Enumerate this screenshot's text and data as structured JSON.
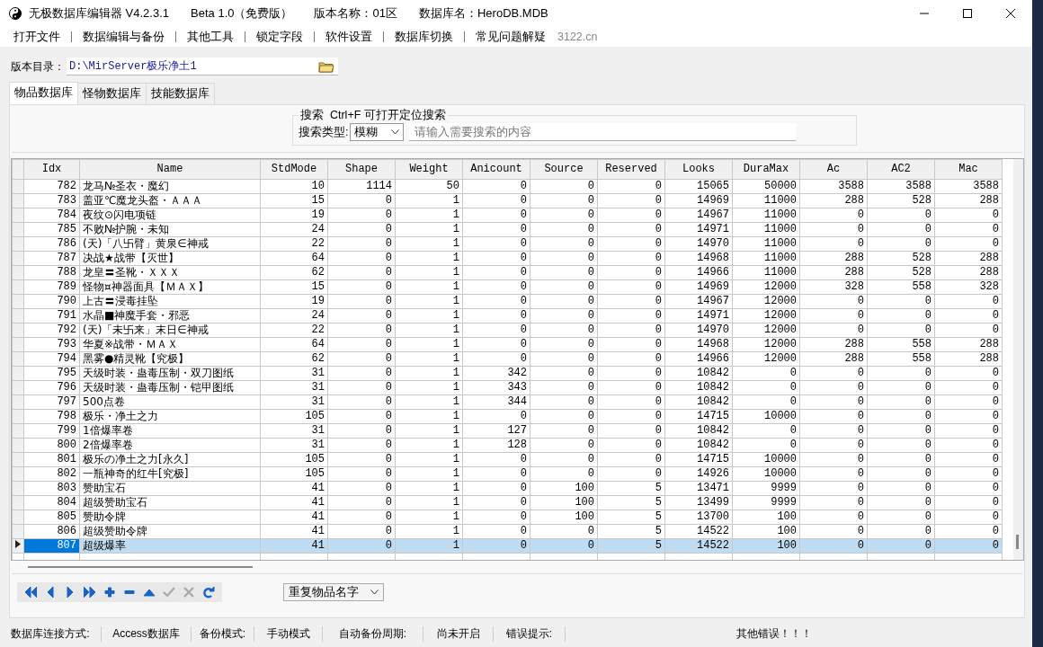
{
  "window": {
    "title_parts": [
      "无极数据库编辑器 V4.2.3.1",
      "Beta 1.0（免费版）",
      "版本名称：01区",
      "数据库名：HeroDB.MDB"
    ]
  },
  "menu": {
    "items": [
      "打开文件",
      "数据编辑与备份",
      "其他工具",
      "锁定字段",
      "软件设置",
      "数据库切换",
      "常见问题解疑"
    ],
    "site": "3122.cn"
  },
  "path": {
    "label": "版本目录：",
    "value": "D:\\MirServer极乐净土1"
  },
  "tabs": [
    {
      "label": "物品数据库",
      "selected": true
    },
    {
      "label": "怪物数据库",
      "selected": false
    },
    {
      "label": "技能数据库",
      "selected": false
    }
  ],
  "search": {
    "legend": "搜索  Ctrl+F 可打开定位搜索",
    "type_label": "搜索类型:",
    "type_value": "模糊",
    "placeholder": "请输入需要搜索的内容"
  },
  "table": {
    "columns": [
      "Idx",
      "Name",
      "StdMode",
      "Shape",
      "Weight",
      "Anicount",
      "Source",
      "Reserved",
      "Looks",
      "DuraMax",
      "Ac",
      "AC2",
      "Mac"
    ],
    "rows": [
      {
        "selected": false,
        "cells": [
          "782",
          "龙马№圣衣・魔幻",
          "10",
          "1114",
          "50",
          "0",
          "0",
          "0",
          "15065",
          "50000",
          "3588",
          "3588",
          "3588"
        ]
      },
      {
        "selected": false,
        "cells": [
          "783",
          "盖亚℃魔龙头盔・ＡＡＡ",
          "15",
          "0",
          "1",
          "0",
          "0",
          "0",
          "14969",
          "11000",
          "288",
          "528",
          "288"
        ]
      },
      {
        "selected": false,
        "cells": [
          "784",
          "夜纹⊙闪电项链",
          "19",
          "0",
          "1",
          "0",
          "0",
          "0",
          "14967",
          "11000",
          "0",
          "0",
          "0"
        ]
      },
      {
        "selected": false,
        "cells": [
          "785",
          "不败№护腕・未知",
          "24",
          "0",
          "1",
          "0",
          "0",
          "0",
          "14971",
          "11000",
          "0",
          "0",
          "0"
        ]
      },
      {
        "selected": false,
        "cells": [
          "786",
          "(天)「八卐臂」黄泉∈神戒",
          "22",
          "0",
          "1",
          "0",
          "0",
          "0",
          "14970",
          "11000",
          "0",
          "0",
          "0"
        ]
      },
      {
        "selected": false,
        "cells": [
          "787",
          "决战★战带【灭世】",
          "64",
          "0",
          "1",
          "0",
          "0",
          "0",
          "14968",
          "11000",
          "288",
          "528",
          "288"
        ]
      },
      {
        "selected": false,
        "cells": [
          "788",
          "龙皇〓圣靴・ＸＸＸ",
          "62",
          "0",
          "1",
          "0",
          "0",
          "0",
          "14966",
          "11000",
          "288",
          "528",
          "288"
        ]
      },
      {
        "selected": false,
        "cells": [
          "789",
          "怪物¤神器面具【ＭＡＸ】",
          "15",
          "0",
          "1",
          "0",
          "0",
          "0",
          "14969",
          "12000",
          "328",
          "558",
          "328"
        ]
      },
      {
        "selected": false,
        "cells": [
          "790",
          "上古〓浸毒挂坠",
          "19",
          "0",
          "1",
          "0",
          "0",
          "0",
          "14967",
          "12000",
          "0",
          "0",
          "0"
        ]
      },
      {
        "selected": false,
        "cells": [
          "791",
          "水晶■神魔手套・邪恶",
          "24",
          "0",
          "1",
          "0",
          "0",
          "0",
          "14971",
          "12000",
          "0",
          "0",
          "0"
        ]
      },
      {
        "selected": false,
        "cells": [
          "792",
          "(天)「未卐来」末日∈神戒",
          "22",
          "0",
          "1",
          "0",
          "0",
          "0",
          "14970",
          "12000",
          "0",
          "0",
          "0"
        ]
      },
      {
        "selected": false,
        "cells": [
          "793",
          "华夏※战带・ＭＡＸ",
          "64",
          "0",
          "1",
          "0",
          "0",
          "0",
          "14968",
          "12000",
          "288",
          "558",
          "288"
        ]
      },
      {
        "selected": false,
        "cells": [
          "794",
          "黑雾●精灵靴【究极】",
          "62",
          "0",
          "1",
          "0",
          "0",
          "0",
          "14966",
          "12000",
          "288",
          "558",
          "288"
        ]
      },
      {
        "selected": false,
        "cells": [
          "795",
          "天级时装・蛊毒压制・双刀图纸",
          "31",
          "0",
          "1",
          "342",
          "0",
          "0",
          "10842",
          "0",
          "0",
          "0",
          "0"
        ]
      },
      {
        "selected": false,
        "cells": [
          "796",
          "天级时装・蛊毒压制・铠甲图纸",
          "31",
          "0",
          "1",
          "343",
          "0",
          "0",
          "10842",
          "0",
          "0",
          "0",
          "0"
        ]
      },
      {
        "selected": false,
        "cells": [
          "797",
          "500点卷",
          "31",
          "0",
          "1",
          "344",
          "0",
          "0",
          "10842",
          "0",
          "0",
          "0",
          "0"
        ]
      },
      {
        "selected": false,
        "cells": [
          "798",
          "极乐・净土之力",
          "105",
          "0",
          "1",
          "0",
          "0",
          "0",
          "14715",
          "10000",
          "0",
          "0",
          "0"
        ]
      },
      {
        "selected": false,
        "cells": [
          "799",
          "1倍爆率卷",
          "31",
          "0",
          "1",
          "127",
          "0",
          "0",
          "10842",
          "0",
          "0",
          "0",
          "0"
        ]
      },
      {
        "selected": false,
        "cells": [
          "800",
          "2倍爆率卷",
          "31",
          "0",
          "1",
          "128",
          "0",
          "0",
          "10842",
          "0",
          "0",
          "0",
          "0"
        ]
      },
      {
        "selected": false,
        "cells": [
          "801",
          "极乐の净土之力[永久]",
          "105",
          "0",
          "1",
          "0",
          "0",
          "0",
          "14715",
          "10000",
          "0",
          "0",
          "0"
        ]
      },
      {
        "selected": false,
        "cells": [
          "802",
          "一瓶神奇的红牛[究极]",
          "105",
          "0",
          "1",
          "0",
          "0",
          "0",
          "14926",
          "10000",
          "0",
          "0",
          "0"
        ]
      },
      {
        "selected": false,
        "cells": [
          "803",
          "赞助宝石",
          "41",
          "0",
          "1",
          "0",
          "100",
          "5",
          "13471",
          "9999",
          "0",
          "0",
          "0"
        ]
      },
      {
        "selected": false,
        "cells": [
          "804",
          "超级赞助宝石",
          "41",
          "0",
          "1",
          "0",
          "100",
          "5",
          "13499",
          "9999",
          "0",
          "0",
          "0"
        ]
      },
      {
        "selected": false,
        "cells": [
          "805",
          "赞助令牌",
          "41",
          "0",
          "1",
          "0",
          "100",
          "5",
          "13700",
          "100",
          "0",
          "0",
          "0"
        ]
      },
      {
        "selected": false,
        "cells": [
          "806",
          "超级赞助令牌",
          "41",
          "0",
          "1",
          "0",
          "0",
          "5",
          "14522",
          "100",
          "0",
          "0",
          "0"
        ]
      },
      {
        "selected": true,
        "cells": [
          "807",
          "超级爆率",
          "41",
          "0",
          "1",
          "0",
          "0",
          "5",
          "14522",
          "100",
          "0",
          "0",
          "0"
        ]
      }
    ]
  },
  "navigator": {
    "buttons": [
      {
        "kind": "first",
        "disabled": false
      },
      {
        "kind": "prior",
        "disabled": false
      },
      {
        "kind": "next",
        "disabled": false
      },
      {
        "kind": "last",
        "disabled": false
      },
      {
        "kind": "insert",
        "disabled": false
      },
      {
        "kind": "delete",
        "disabled": false
      },
      {
        "kind": "edit",
        "disabled": false
      },
      {
        "kind": "post",
        "disabled": true
      },
      {
        "kind": "cancel",
        "disabled": true
      },
      {
        "kind": "refresh",
        "disabled": false
      }
    ],
    "dropdown": "重复物品名字"
  },
  "status_bar": [
    "数据库连接方式:",
    "Access数据库",
    "备份模式:",
    "手动模式",
    "自动备份周期:",
    "尚未开启",
    "错误提示:",
    "其他错误！！！"
  ]
}
